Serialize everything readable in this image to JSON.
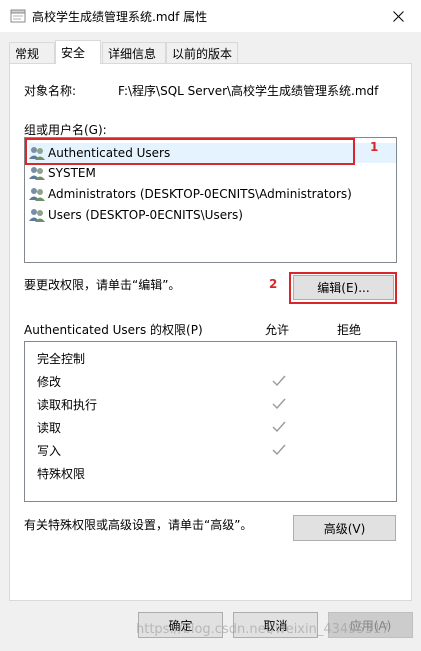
{
  "window": {
    "title": "高校学生成绩管理系统.mdf 属性"
  },
  "tabs": [
    {
      "label": "常规"
    },
    {
      "label": "安全"
    },
    {
      "label": "详细信息"
    },
    {
      "label": "以前的版本"
    }
  ],
  "security": {
    "object_label": "对象名称:",
    "object_value": "F:\\程序\\SQL Server\\高校学生成绩管理系统.mdf",
    "groups_label": "组或用户名(G):",
    "users": [
      {
        "name": "Authenticated Users"
      },
      {
        "name": "SYSTEM"
      },
      {
        "name": "Administrators (DESKTOP-0ECNITS\\Administrators)"
      },
      {
        "name": "Users (DESKTOP-0ECNITS\\Users)"
      }
    ],
    "change_text": "要更改权限，请单击“编辑”。",
    "edit_button": "编辑(E)...",
    "perm_label": "Authenticated Users 的权限(P)",
    "allow_header": "允许",
    "deny_header": "拒绝",
    "permissions": [
      {
        "name": "完全控制",
        "allow": false
      },
      {
        "name": "修改",
        "allow": true
      },
      {
        "name": "读取和执行",
        "allow": true
      },
      {
        "name": "读取",
        "allow": true
      },
      {
        "name": "写入",
        "allow": true
      },
      {
        "name": "特殊权限",
        "allow": false
      }
    ],
    "advanced_text": "有关特殊权限或高级设置，请单击“高级”。",
    "advanced_button": "高级(V)"
  },
  "annotations": {
    "mark1": "1",
    "mark2": "2"
  },
  "footer": {
    "ok": "确定",
    "cancel": "取消",
    "apply": "应用(A)"
  },
  "watermark": "https://blog.csdn.net/weixin_43495317",
  "colors": {
    "annotation_red": "#d9262b",
    "selection": "#e5f3ff",
    "check_gray": "#9a9a9a"
  }
}
